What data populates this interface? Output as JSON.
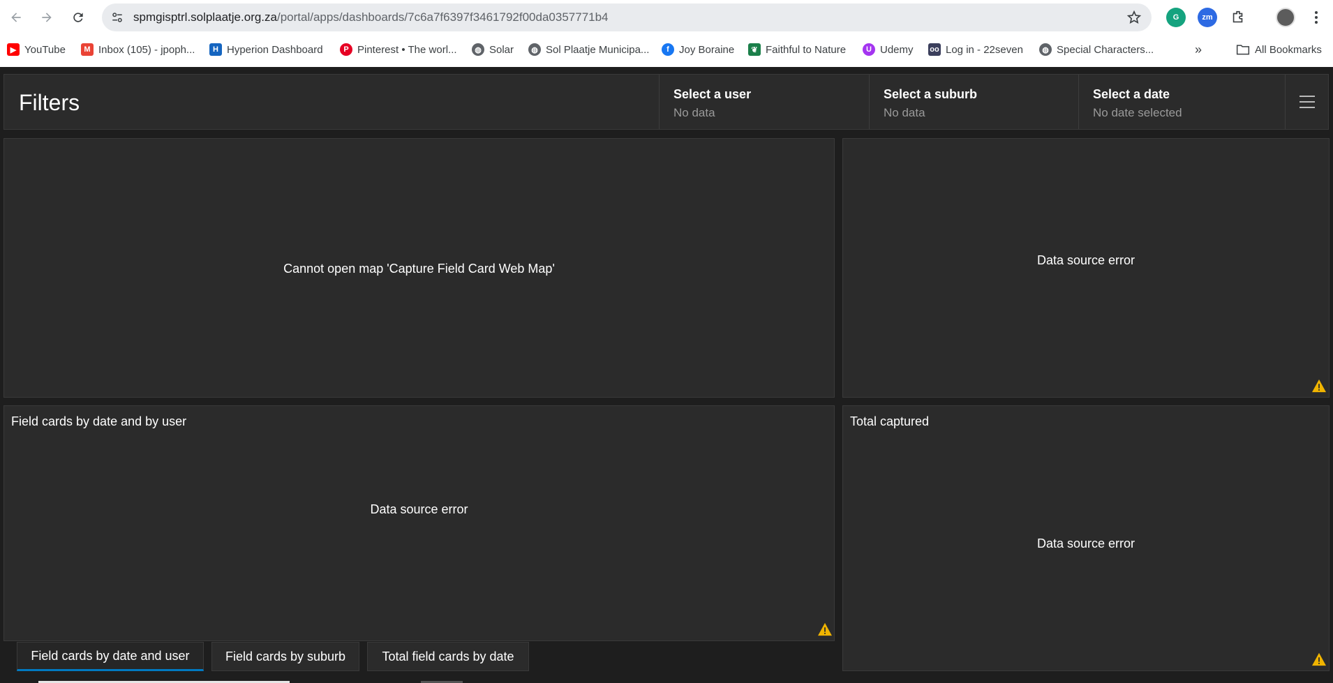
{
  "browser": {
    "url_host": "spmgisptrl.solplaatje.org.za",
    "url_path": "/portal/apps/dashboards/7c6a7f6397f3461792f00da0357771b4",
    "bookmarks": [
      {
        "label": "YouTube",
        "icon": "youtube-icon",
        "color": "#ff0000"
      },
      {
        "label": "Inbox (105) - jpoph...",
        "icon": "gmail-icon",
        "color": "#ea4335"
      },
      {
        "label": "Hyperion Dashboard",
        "icon": "hyperion-icon",
        "color": "#1565c0"
      },
      {
        "label": "Pinterest • The worl...",
        "icon": "pinterest-icon",
        "color": "#e60023"
      },
      {
        "label": "Solar",
        "icon": "globe-icon",
        "color": "#5f6368"
      },
      {
        "label": "Sol Plaatje Municipa...",
        "icon": "globe-icon",
        "color": "#5f6368"
      },
      {
        "label": "Joy Boraine",
        "icon": "facebook-icon",
        "color": "#1877f2"
      },
      {
        "label": "Faithful to Nature",
        "icon": "leaf-icon",
        "color": "#1b7f4a"
      },
      {
        "label": "Udemy",
        "icon": "udemy-icon",
        "color": "#a435f0"
      },
      {
        "label": "Log in - 22seven",
        "icon": "22seven-icon",
        "color": "#3b3f5c"
      },
      {
        "label": "Special Characters...",
        "icon": "globe-icon",
        "color": "#5f6368"
      }
    ],
    "all_bookmarks": "All Bookmarks"
  },
  "dashboard": {
    "title": "Filters",
    "selectors": [
      {
        "label": "Select a user",
        "value": "No data"
      },
      {
        "label": "Select a suburb",
        "value": "No data"
      },
      {
        "label": "Select a date",
        "value": "No date selected"
      }
    ],
    "map_panel": {
      "message": "Cannot open map 'Capture Field Card Web Map'"
    },
    "top_right_panel": {
      "message": "Data source error"
    },
    "chart_panel": {
      "title": "Field cards by date and by user",
      "message": "Data source error"
    },
    "total_panel": {
      "title": "Total captured",
      "message": "Data source error"
    },
    "tabs": [
      {
        "label": "Field cards by date and user",
        "active": true
      },
      {
        "label": "Field cards by suburb",
        "active": false
      },
      {
        "label": "Total field cards by date",
        "active": false
      }
    ],
    "colors": {
      "accent": "#0079c1",
      "warning": "#f0b400",
      "panel": "#2b2b2b"
    }
  }
}
